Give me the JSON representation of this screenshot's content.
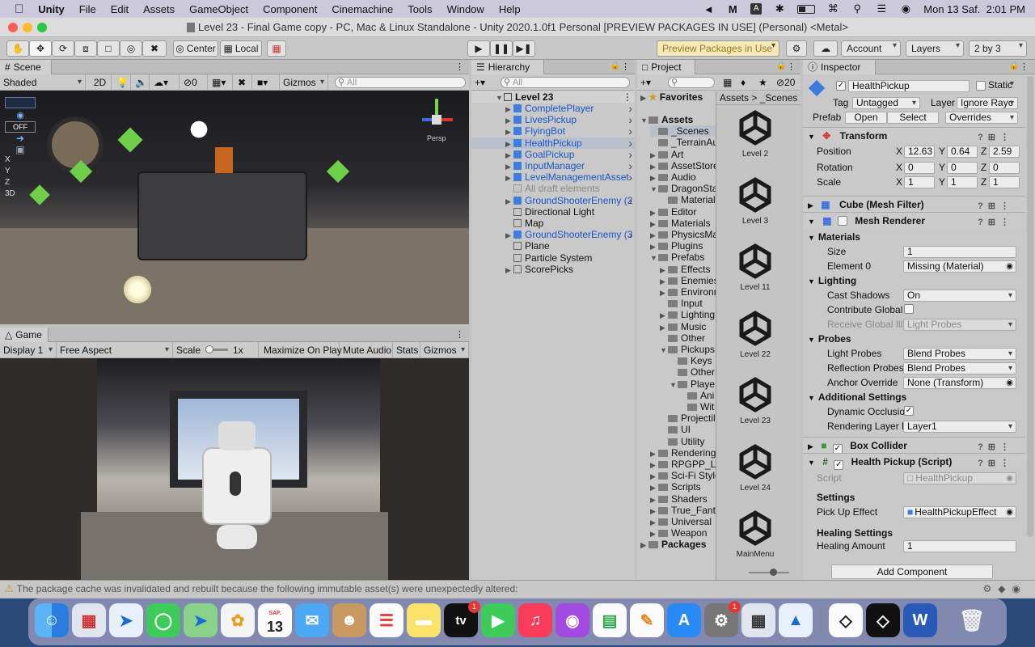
{
  "menubar": {
    "app": "Unity",
    "items": [
      "File",
      "Edit",
      "Assets",
      "GameObject",
      "Component",
      "Cinemachine",
      "Tools",
      "Window",
      "Help"
    ],
    "datetime": "Mon 13 Saf.  2:01 PM",
    "icons": [
      "unity-hub-icon",
      "malwarebytes-icon",
      "input-a-icon",
      "bluetooth-icon",
      "battery-icon",
      "wifi-icon",
      "search-icon",
      "control-center-icon",
      "siri-icon"
    ]
  },
  "window": {
    "title": "Level 23 - Final Game copy - PC, Mac & Linux Standalone - Unity 2020.1.0f1 Personal [PREVIEW PACKAGES IN USE] (Personal) <Metal>"
  },
  "toolbar": {
    "pivot": "Center",
    "space": "Local",
    "preview_packages": "Preview Packages in Use",
    "account": "Account",
    "layers": "Layers",
    "layout": "2 by 3"
  },
  "scene": {
    "tab": "Scene",
    "shading": "Shaded",
    "mode2d": "2D",
    "hidden_count": "0",
    "gizmos": "Gizmos",
    "search_placeholder": "All",
    "persp_label": "Persp",
    "overlay": [
      "OFF",
      "X",
      "Y",
      "Z",
      "3D"
    ]
  },
  "game": {
    "tab": "Game",
    "display": "Display 1",
    "aspect": "Free Aspect",
    "scale_label": "Scale",
    "scale_value": "1x",
    "maximize": "Maximize On Play",
    "mute": "Mute Audio",
    "stats": "Stats",
    "gizmos": "Gizmos"
  },
  "hierarchy": {
    "tab": "Hierarchy",
    "search_placeholder": "All",
    "scene": "Level 23",
    "items": [
      {
        "label": "CompletePlayer",
        "style": "blue",
        "icon": "prefab"
      },
      {
        "label": "LivesPickup",
        "style": "blue",
        "icon": "prefab"
      },
      {
        "label": "FlyingBot",
        "style": "blue",
        "icon": "prefab"
      },
      {
        "label": "HealthPickup",
        "style": "blue",
        "icon": "prefab",
        "selected": true
      },
      {
        "label": "GoalPickup",
        "style": "blue",
        "icon": "prefab"
      },
      {
        "label": "InputManager",
        "style": "blue",
        "icon": "prefab"
      },
      {
        "label": "LevelManagementAsset",
        "style": "blue",
        "icon": "prefab"
      },
      {
        "label": "All draft elements",
        "style": "grey",
        "icon": "object"
      },
      {
        "label": "GroundShooterEnemy (2",
        "style": "blue",
        "icon": "prefab"
      },
      {
        "label": "Directional Light",
        "style": "normal",
        "icon": "object"
      },
      {
        "label": "Map",
        "style": "normal",
        "icon": "object"
      },
      {
        "label": "GroundShooterEnemy (3",
        "style": "blue",
        "icon": "prefab"
      },
      {
        "label": "Plane",
        "style": "normal",
        "icon": "object"
      },
      {
        "label": "Particle System",
        "style": "normal",
        "icon": "object"
      },
      {
        "label": "ScorePicks",
        "style": "normal",
        "icon": "object"
      }
    ]
  },
  "project": {
    "tab": "Project",
    "hidden_count": "20",
    "favorites": "Favorites",
    "tree": [
      {
        "label": "Assets",
        "depth": 0,
        "bold": true
      },
      {
        "label": "_Scenes",
        "depth": 1,
        "selected": true
      },
      {
        "label": "_TerrainAu",
        "depth": 1
      },
      {
        "label": "Art",
        "depth": 1
      },
      {
        "label": "AssetStore",
        "depth": 1
      },
      {
        "label": "Audio",
        "depth": 1
      },
      {
        "label": "DragonSta",
        "depth": 1
      },
      {
        "label": "Material",
        "depth": 2
      },
      {
        "label": "Editor",
        "depth": 1
      },
      {
        "label": "Materials",
        "depth": 1
      },
      {
        "label": "PhysicsMa",
        "depth": 1
      },
      {
        "label": "Plugins",
        "depth": 1
      },
      {
        "label": "Prefabs",
        "depth": 1
      },
      {
        "label": "Effects",
        "depth": 2
      },
      {
        "label": "Enemies",
        "depth": 2
      },
      {
        "label": "Environn",
        "depth": 2
      },
      {
        "label": "Input",
        "depth": 2
      },
      {
        "label": "Lighting",
        "depth": 2
      },
      {
        "label": "Music",
        "depth": 2
      },
      {
        "label": "Other",
        "depth": 2
      },
      {
        "label": "Pickups",
        "depth": 2
      },
      {
        "label": "Keys",
        "depth": 3
      },
      {
        "label": "Other",
        "depth": 3
      },
      {
        "label": "Playe",
        "depth": 3
      },
      {
        "label": "Ani",
        "depth": 4
      },
      {
        "label": "Wit",
        "depth": 4
      },
      {
        "label": "Projectil",
        "depth": 2
      },
      {
        "label": "UI",
        "depth": 2
      },
      {
        "label": "Utility",
        "depth": 2
      },
      {
        "label": "Rendering",
        "depth": 1
      },
      {
        "label": "RPGPP_LT",
        "depth": 1
      },
      {
        "label": "Sci-Fi Style",
        "depth": 1
      },
      {
        "label": "Scripts",
        "depth": 1
      },
      {
        "label": "Shaders",
        "depth": 1
      },
      {
        "label": "True_Fanta",
        "depth": 1
      },
      {
        "label": "Universal",
        "depth": 1
      },
      {
        "label": "Weapon",
        "depth": 1
      },
      {
        "label": "Packages",
        "depth": 0,
        "bold": true
      }
    ],
    "breadcrumb": [
      "Assets",
      "_Scenes"
    ],
    "files": [
      "Level 2",
      "Level 3",
      "Level 11",
      "Level 22",
      "Level 23",
      "Level 24",
      "MainMenu"
    ]
  },
  "inspector": {
    "tab": "Inspector",
    "object_name": "HealthPickup",
    "static_label": "Static",
    "tag_label": "Tag",
    "tag_value": "Untagged",
    "layer_label": "Layer",
    "layer_value": "Ignore Rayc",
    "prefab_label": "Prefab",
    "prefab_open": "Open",
    "prefab_select": "Select",
    "prefab_overrides": "Overrides",
    "transform": {
      "title": "Transform",
      "position_label": "Position",
      "rotation_label": "Rotation",
      "scale_label": "Scale",
      "position": {
        "x": "12.63",
        "y": "0.64",
        "z": "2.59"
      },
      "rotation": {
        "x": "0",
        "y": "0",
        "z": "0"
      },
      "scale": {
        "x": "1",
        "y": "1",
        "z": "1"
      }
    },
    "mesh_filter": {
      "title": "Cube (Mesh Filter)"
    },
    "mesh_renderer": {
      "title": "Mesh Renderer",
      "materials_label": "Materials",
      "size_label": "Size",
      "size_value": "1",
      "element0_label": "Element 0",
      "element0_value": "Missing (Material)",
      "lighting_label": "Lighting",
      "cast_shadows_label": "Cast Shadows",
      "cast_shadows_value": "On",
      "contribute_gi_label": "Contribute Global I",
      "receive_gi_label": "Receive Global Illu",
      "receive_gi_value": "Light Probes",
      "probes_label": "Probes",
      "light_probes_label": "Light Probes",
      "light_probes_value": "Blend Probes",
      "reflection_probes_label": "Reflection Probes",
      "reflection_probes_value": "Blend Probes",
      "anchor_label": "Anchor Override",
      "anchor_value": "None (Transform)",
      "additional_label": "Additional Settings",
      "dynamic_occlusion_label": "Dynamic Occlusio",
      "rendering_layer_label": "Rendering Layer M",
      "rendering_layer_value": "Layer1"
    },
    "box_collider": {
      "title": "Box Collider"
    },
    "health_pickup": {
      "title": "Health Pickup (Script)",
      "script_label": "Script",
      "script_value": "HealthPickup",
      "settings_label": "Settings",
      "pickup_effect_label": "Pick Up Effect",
      "pickup_effect_value": "HealthPickupEffect",
      "healing_settings_label": "Healing Settings",
      "healing_amount_label": "Healing Amount",
      "healing_amount_value": "1"
    },
    "add_component": "Add Component"
  },
  "status": {
    "message": "The package cache was invalidated and rebuilt because the following immutable asset(s) were unexpectedly altered:"
  },
  "dock": {
    "calendar_month": "SAF.",
    "calendar_day": "13",
    "appletv_label": "tv",
    "badge_count": "1"
  }
}
